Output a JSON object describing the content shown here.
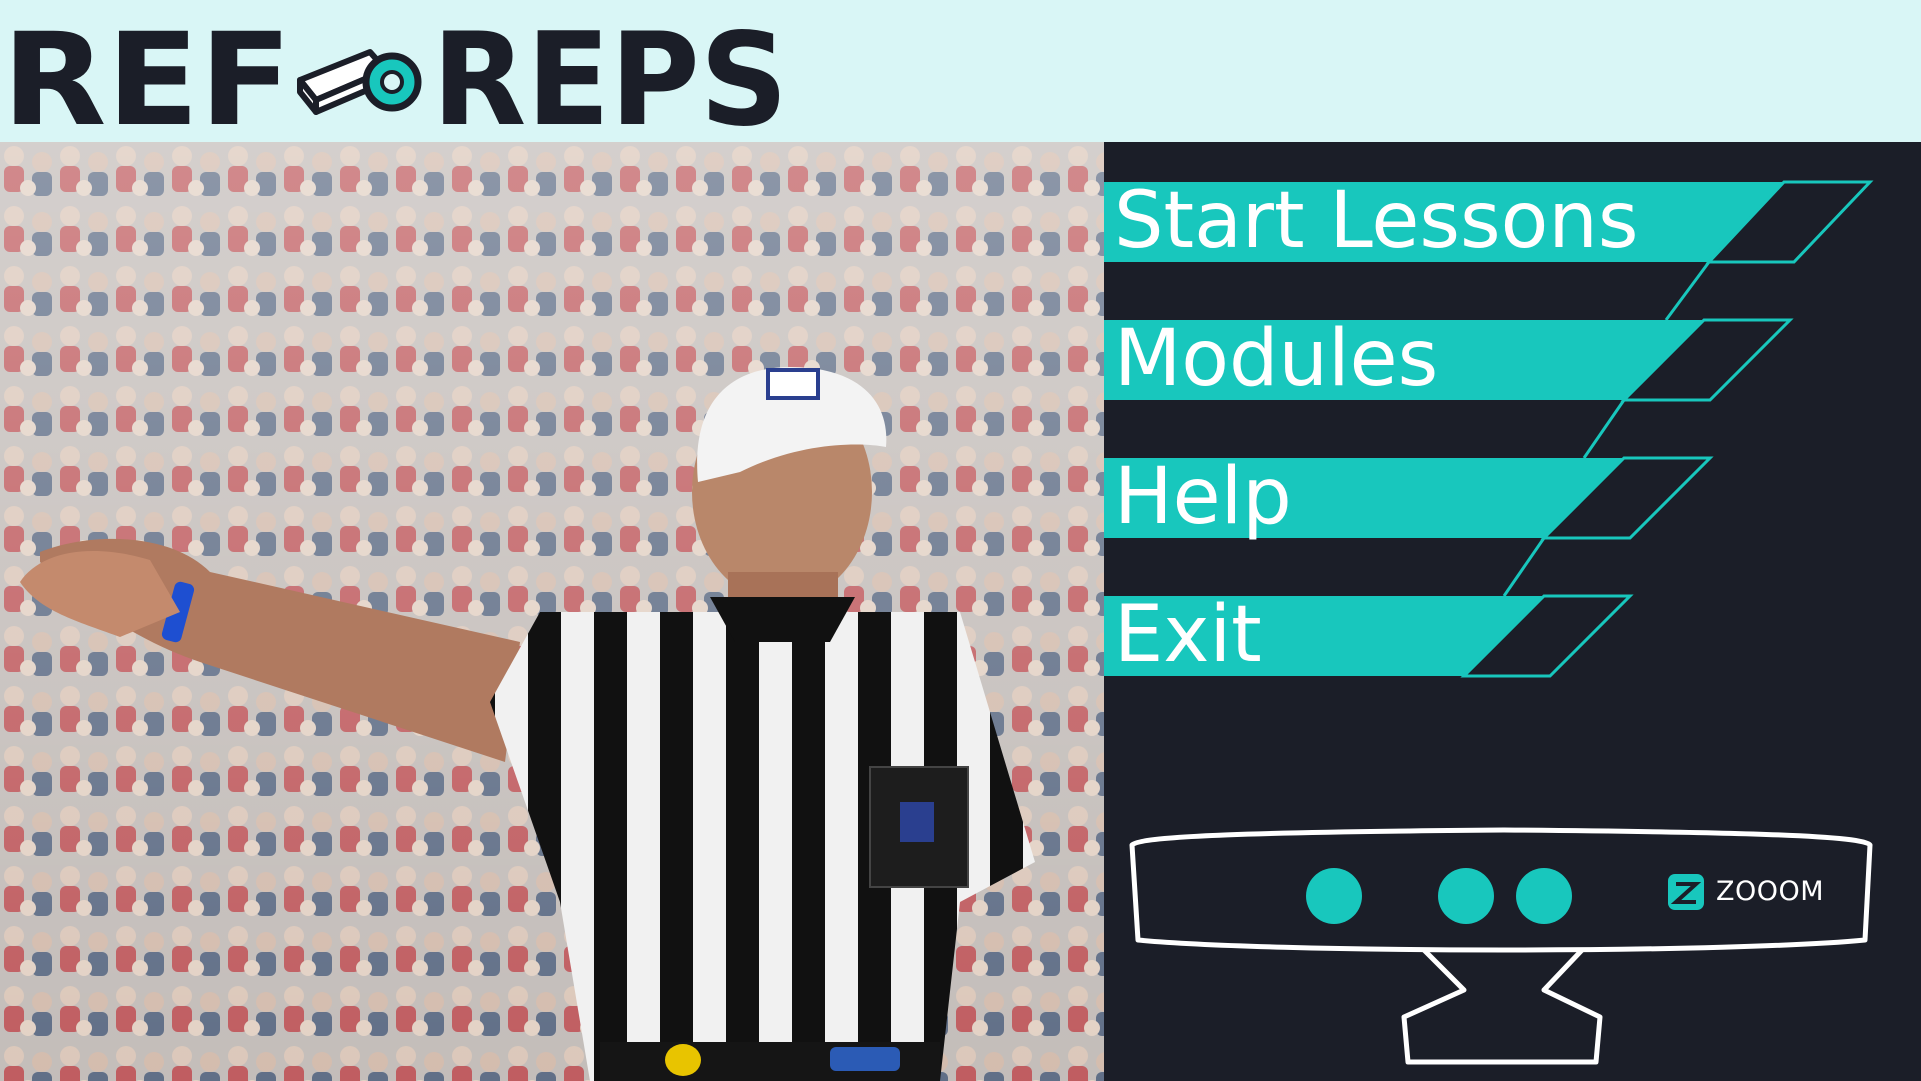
{
  "header": {
    "brand_left": "REF",
    "brand_right": "REPS",
    "logo_icon": "whistle-icon"
  },
  "menu": {
    "items": [
      {
        "label": "Start Lessons"
      },
      {
        "label": "Modules"
      },
      {
        "label": "Help"
      },
      {
        "label": "Exit"
      }
    ]
  },
  "device": {
    "brand": "ZOOOM",
    "icon": "zooom-logo-icon"
  },
  "colors": {
    "header_bg": "#d9f6f6",
    "panel_bg": "#1b1e28",
    "accent": "#18c7bd",
    "text_dark": "#1b1e28",
    "text_light": "#ffffff"
  }
}
